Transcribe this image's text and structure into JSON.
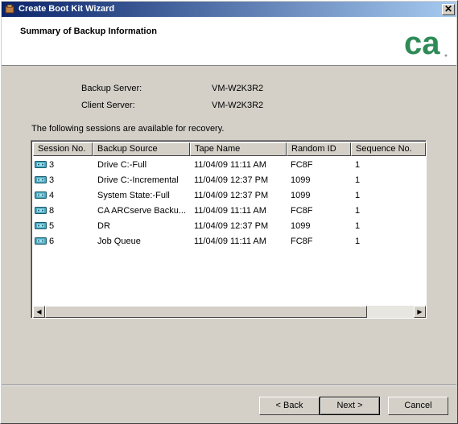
{
  "window": {
    "title": "Create Boot Kit Wizard",
    "close_glyph": "✕"
  },
  "header": {
    "heading": "Summary of Backup Information",
    "logo_text": "ca"
  },
  "info": {
    "backup_server_label": "Backup Server:",
    "backup_server_value": "VM-W2K3R2",
    "client_server_label": "Client Server:",
    "client_server_value": "VM-W2K3R2"
  },
  "sessions_caption": "The following sessions are available for recovery.",
  "table": {
    "columns": [
      "Session No.",
      "Backup Source",
      "Tape Name",
      "Random ID",
      "Sequence No."
    ],
    "rows": [
      {
        "session": "3",
        "source": "Drive C:-Full",
        "tape": "11/04/09 11:11 AM",
        "random_id": "FC8F",
        "sequence": "1"
      },
      {
        "session": "3",
        "source": "Drive C:-Incremental",
        "tape": "11/04/09 12:37 PM",
        "random_id": "1099",
        "sequence": "1"
      },
      {
        "session": "4",
        "source": "System State:-Full",
        "tape": "11/04/09 12:37 PM",
        "random_id": "1099",
        "sequence": "1"
      },
      {
        "session": "8",
        "source": "CA ARCserve Backu...",
        "tape": "11/04/09 11:11 AM",
        "random_id": "FC8F",
        "sequence": "1"
      },
      {
        "session": "5",
        "source": "DR",
        "tape": "11/04/09 12:37 PM",
        "random_id": "1099",
        "sequence": "1"
      },
      {
        "session": "6",
        "source": "Job Queue",
        "tape": "11/04/09 11:11 AM",
        "random_id": "FC8F",
        "sequence": "1"
      }
    ]
  },
  "scrollbar": {
    "left_arrow": "◀",
    "right_arrow": "▶"
  },
  "buttons": {
    "back": "< Back",
    "next": "Next >",
    "cancel": "Cancel"
  }
}
